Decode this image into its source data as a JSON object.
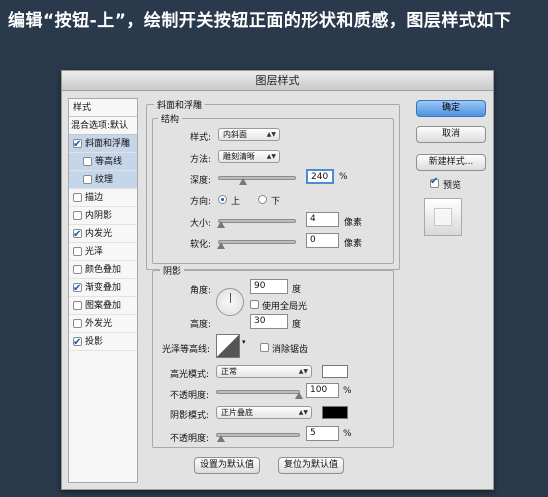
{
  "banner": "编辑“按钮-上”，绘制开关按钮正面的形状和质感，图层样式如下",
  "dialog": {
    "title": "图层样式",
    "styles_panel": {
      "header": "样式",
      "blend_options": "混合选项:默认",
      "items": [
        {
          "label": "斜面和浮雕",
          "checked": true,
          "selected": true
        },
        {
          "label": "等高线",
          "checked": false,
          "selected": true,
          "sub": true
        },
        {
          "label": "纹理",
          "checked": false,
          "selected": true,
          "sub": true
        },
        {
          "label": "描边",
          "checked": false
        },
        {
          "label": "内阴影",
          "checked": false
        },
        {
          "label": "内发光",
          "checked": true
        },
        {
          "label": "光泽",
          "checked": false
        },
        {
          "label": "颜色叠加",
          "checked": false
        },
        {
          "label": "渐变叠加",
          "checked": true
        },
        {
          "label": "图案叠加",
          "checked": false
        },
        {
          "label": "外发光",
          "checked": false
        },
        {
          "label": "投影",
          "checked": true
        }
      ]
    },
    "bevel": {
      "title": "斜面和浮雕",
      "structure_title": "结构",
      "style_label": "样式:",
      "style_value": "内斜面",
      "technique_label": "方法:",
      "technique_value": "雕刻清晰",
      "depth_label": "深度:",
      "depth_value": "240",
      "depth_unit": "%",
      "direction_label": "方向:",
      "direction_up": "上",
      "direction_down": "下",
      "size_label": "大小:",
      "size_value": "4",
      "size_unit": "像素",
      "soften_label": "软化:",
      "soften_value": "0",
      "soften_unit": "像素"
    },
    "shading": {
      "title": "阴影",
      "angle_label": "角度:",
      "angle_value": "90",
      "angle_unit": "度",
      "global_light_label": "使用全局光",
      "altitude_label": "高度:",
      "altitude_value": "30",
      "altitude_unit": "度",
      "gloss_label": "光泽等高线:",
      "antialias_label": "消除锯齿",
      "highlight_mode_label": "高光模式:",
      "highlight_mode_value": "正常",
      "highlight_opacity_label": "不透明度:",
      "highlight_opacity_value": "100",
      "highlight_opacity_unit": "%",
      "shadow_mode_label": "阴影模式:",
      "shadow_mode_value": "正片叠底",
      "shadow_opacity_label": "不透明度:",
      "shadow_opacity_value": "5",
      "shadow_opacity_unit": "%",
      "highlight_color": "#ffffff",
      "shadow_color": "#000000"
    },
    "make_default": "设置为默认值",
    "reset_default": "复位为默认值",
    "ok": "确定",
    "cancel": "取消",
    "new_style": "新建样式...",
    "preview_label": "预览"
  }
}
